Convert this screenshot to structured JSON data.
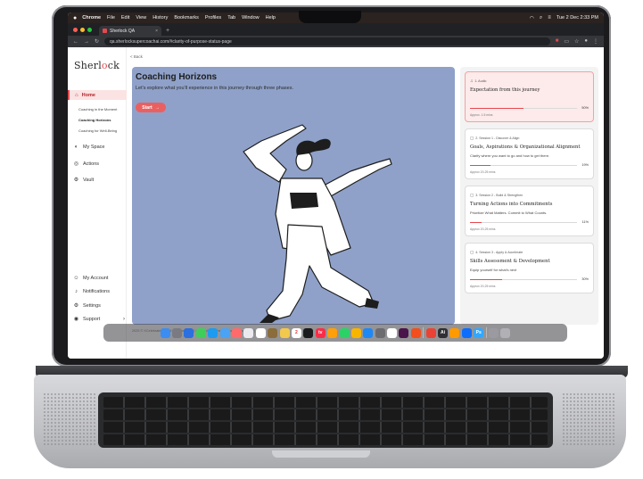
{
  "menubar": {
    "apple": "",
    "items": [
      "Chrome",
      "File",
      "Edit",
      "View",
      "History",
      "Bookmarks",
      "Profiles",
      "Tab",
      "Window",
      "Help"
    ],
    "datetime": "Tue 2 Dec  2:33 PM"
  },
  "browser": {
    "tab_title": "Sherlock QA",
    "url": "qa.sherlocksupercoachai.com/#clarity-of-purpose-status-page"
  },
  "sidebar": {
    "logo_pre": "Sherl",
    "logo_o": "o",
    "logo_post": "ck",
    "home": "Home",
    "sub_items": [
      "Coaching in the Moment",
      "Coaching Horizons",
      "Coaching for Well-Being"
    ],
    "my_space": "My Space",
    "actions": "Actions",
    "vault": "Vault",
    "my_account": "My Account",
    "notifications": "Notifications",
    "settings": "Settings",
    "support": "Support"
  },
  "main": {
    "back": "< Back",
    "title": "Coaching Horizons",
    "lead": "Let's explore what you'll experience in this journey through three phases.",
    "start": "Start",
    "footer": "2025 © XCelebrate Global Solutions Inc. | Sherlock AI (SherlockSuperCoach AI™)"
  },
  "phases": [
    {
      "tag": "1. Audio",
      "title": "Expectation from this journey",
      "desc": "",
      "progress": 50,
      "pct": "50%",
      "duration": "Approx. 1.5 mins",
      "active": true
    },
    {
      "tag": "2. Session 1 - Discover & Align",
      "title": "Goals, Aspirations & Organizational Alignment",
      "desc": "Clarify where you want to go and how to get there.",
      "progress": 19,
      "pct": "19%",
      "duration": "Approx 20-25 mins",
      "active": false
    },
    {
      "tag": "3. Session 2 - Build & Strengthen",
      "title": "Turning Actions into Commitments",
      "desc": "Prioritize What Matters. Commit to What Counts.",
      "progress": 11,
      "pct": "11%",
      "duration": "Approx 20-25 mins",
      "active": false
    },
    {
      "tag": "4. Session 3 - Apply & Accelerate",
      "title": "Skills Assessment & Development",
      "desc": "Equip yourself for what's next",
      "progress": 30,
      "pct": "30%",
      "duration": "Approx 20-25 mins",
      "active": false
    }
  ],
  "dock": {
    "calendar_day": "2",
    "ai_label": "Ai",
    "ps_label": "Ps",
    "tv_label": "tv",
    "colors": [
      "#3b8df2",
      "#7a7a82",
      "#2b6fe0",
      "#3ecf5a",
      "#1d9bf0",
      "#4aa3f5",
      "#ff6b6b",
      "#e9e9ee",
      "#ffffff",
      "#8a6d3b",
      "#f2c94c",
      "#ffffff",
      "#1b1b1d",
      "#fa2d48",
      "#ff9f0a",
      "#2bd366",
      "#f7b500",
      "#1e88f5",
      "#6b6b70",
      "#ffffff",
      "#4a154b",
      "#f24e1e",
      "#ea4335",
      "#2f2f34",
      "#ff9a00",
      "#0d6efd",
      "#31a8ff",
      "#9a9aa0",
      "#b0b0b5"
    ]
  }
}
